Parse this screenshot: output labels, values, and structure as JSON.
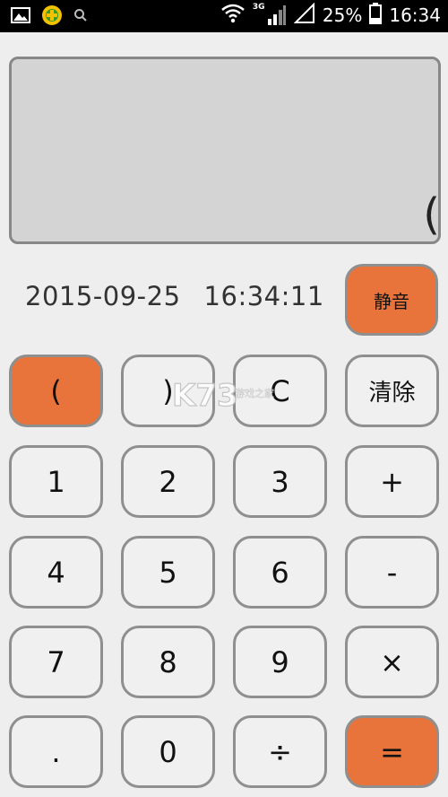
{
  "status_bar": {
    "network_type": "3G",
    "battery_percent": "25%",
    "time": "16:34",
    "icons": [
      "image-icon",
      "app-badge-icon",
      "search-icon",
      "wifi-icon",
      "signal-icon",
      "battery-icon"
    ]
  },
  "display": {
    "expression": "("
  },
  "datetime": {
    "date": "2015-09-25",
    "time": "16:34:11"
  },
  "buttons": {
    "mute": "静音",
    "open_paren": "(",
    "close_paren": ")",
    "c": "C",
    "clear": "清除",
    "one": "1",
    "two": "2",
    "three": "3",
    "plus": "+",
    "four": "4",
    "five": "5",
    "six": "6",
    "minus": "-",
    "seven": "7",
    "eight": "8",
    "nine": "9",
    "multiply": "×",
    "dot": ".",
    "zero": "0",
    "divide": "÷",
    "equals": "="
  },
  "watermark": {
    "logo": "K73",
    "tagline": "游戏之家"
  },
  "colors": {
    "accent": "#e8743b",
    "display_bg": "#d4d4d4",
    "button_bg": "#f0f0f0",
    "page_bg": "#eeeeee"
  }
}
